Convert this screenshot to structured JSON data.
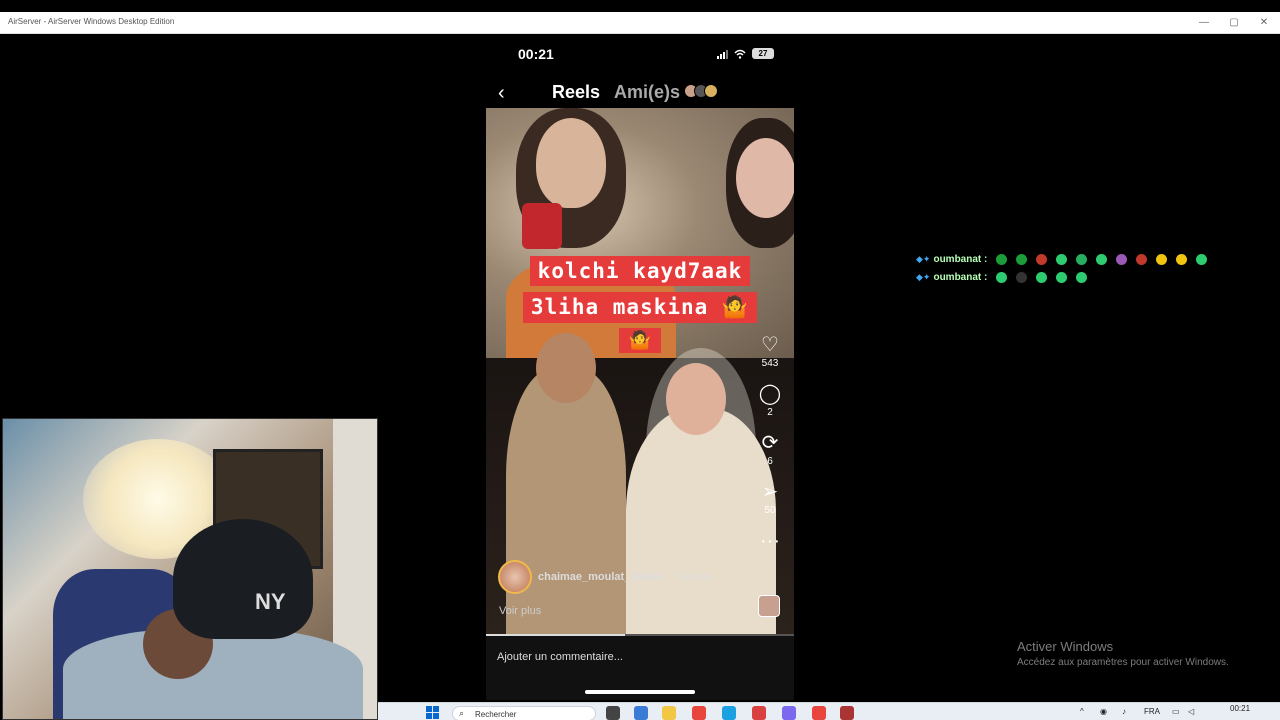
{
  "window": {
    "title": "AirServer - AirServer Windows Desktop Edition",
    "controls": {
      "minimize": "—",
      "maximize": "▢",
      "close": "✕"
    }
  },
  "phone": {
    "status": {
      "time": "00:21",
      "battery": "27"
    },
    "nav": {
      "back": "‹",
      "reels": "Reels",
      "friends": "Ami(e)s"
    },
    "caption": {
      "line1": "kolchi kayd7aak",
      "line2": "3liha maskina 🤷",
      "line3": "🤷"
    },
    "actions": {
      "likes": "543",
      "comments": "2",
      "reposts": "6",
      "shares": "50",
      "more": "···"
    },
    "author": {
      "name": "chaimae_moulat_dahka",
      "follow": "Suivre",
      "see_more": "Voir plus"
    },
    "progress": 0.45,
    "comment_placeholder": "Ajouter un commentaire..."
  },
  "chat": {
    "lines": [
      {
        "user": "oumbanat :",
        "emotes": [
          "#1b9e3a",
          "#1b9e3a",
          "#c0392b",
          "#2ecc71",
          "#27ae60",
          "#2ecc71",
          "#9b59b6",
          "#c0392b",
          "#f1c40f",
          "#f1c40f",
          "#2ecc71"
        ]
      },
      {
        "user": "oumbanat :",
        "emotes": [
          "#2ecc71",
          "#333333",
          "#2ecc71",
          "#2ecc71",
          "#2ecc71"
        ]
      }
    ]
  },
  "activation": {
    "title": "Activer Windows",
    "subtitle": "Accédez aux paramètres pour activer Windows."
  },
  "taskbar": {
    "search": "Rechercher",
    "tray_lang": "FRA",
    "clock_time": "00:21"
  }
}
